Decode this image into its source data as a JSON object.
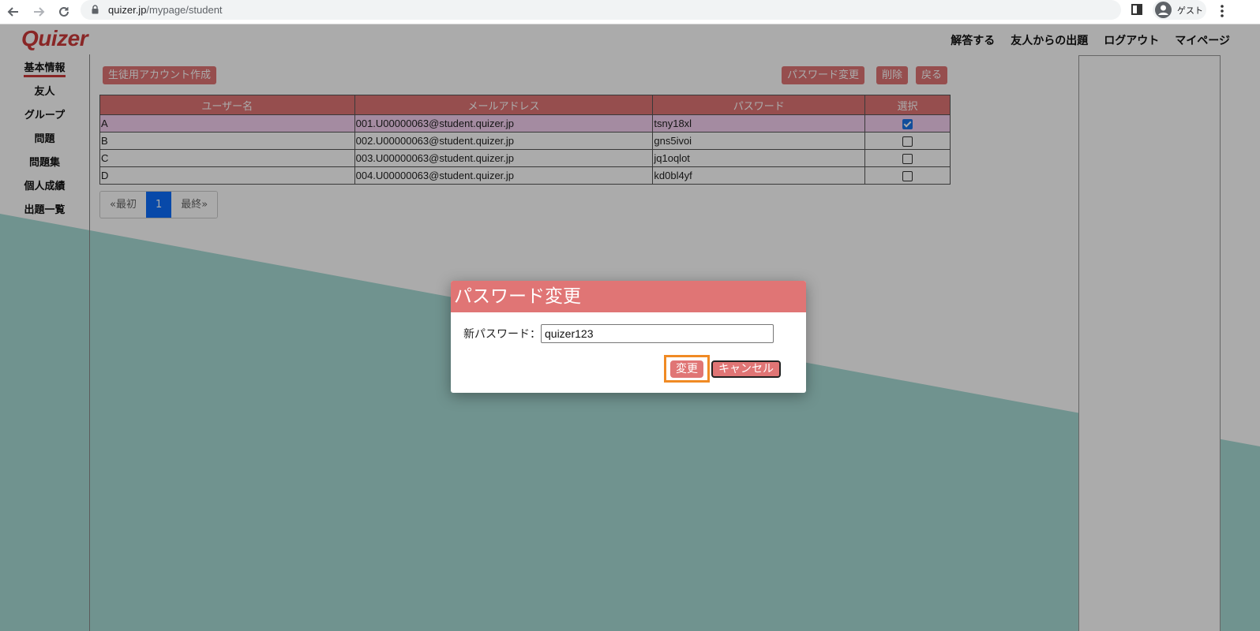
{
  "browser": {
    "url_host": "quizer.jp",
    "url_path": "/mypage/student",
    "profile_label": "ゲスト"
  },
  "app": {
    "logo": "Quizer",
    "top_nav": [
      "解答する",
      "友人からの出題",
      "ログアウト",
      "マイページ"
    ],
    "sidebar": [
      "基本情報",
      "友人",
      "グループ",
      "問題",
      "問題集",
      "個人成績",
      "出題一覧"
    ],
    "active_sidebar": "基本情報"
  },
  "toolbar": {
    "create_account": "生徒用アカウント作成",
    "change_password": "パスワード変更",
    "delete": "削除",
    "back": "戻る"
  },
  "table": {
    "headers": [
      "ユーザー名",
      "メールアドレス",
      "パスワード",
      "選択"
    ],
    "rows": [
      {
        "username": "A",
        "email": "001.U00000063@student.quizer.jp",
        "password": "tsny18xl",
        "selected": true
      },
      {
        "username": "B",
        "email": "002.U00000063@student.quizer.jp",
        "password": "gns5ivoi",
        "selected": false
      },
      {
        "username": "C",
        "email": "003.U00000063@student.quizer.jp",
        "password": "jq1oqlot",
        "selected": false
      },
      {
        "username": "D",
        "email": "004.U00000063@student.quizer.jp",
        "password": "kd0bl4yf",
        "selected": false
      }
    ]
  },
  "pagination": {
    "first": "«最初",
    "current": "1",
    "last": "最終»"
  },
  "modal": {
    "title": "パスワード変更",
    "label": "新パスワード：",
    "input_value": "quizer123",
    "submit": "変更",
    "cancel": "キャンセル"
  },
  "colors": {
    "accent": "#e07575",
    "logo": "#cc3a3a",
    "teal": "#a8dcd6",
    "highlight": "#f08a24"
  }
}
